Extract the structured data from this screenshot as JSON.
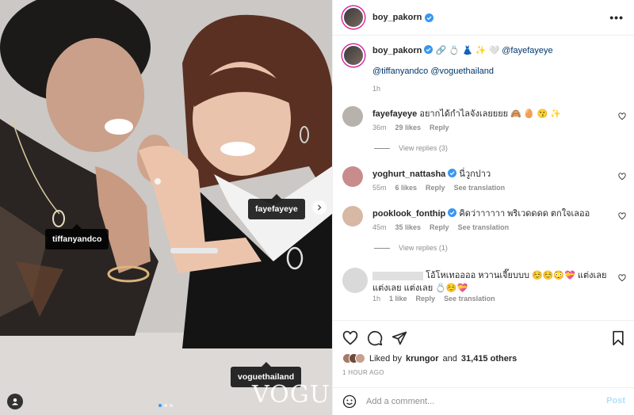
{
  "photo": {
    "tags": {
      "tiffany": "tiffanyandco",
      "faye": "fayefayeye",
      "vogue": "voguethailand"
    },
    "logo_text": "VOGUE"
  },
  "post": {
    "username": "boy_pakorn",
    "more_icon": "ellipsis-icon",
    "caption": {
      "emojis": "🔗 💍 👗 ✨ 🤍",
      "mention1": "@fayefayeye",
      "mention2": "@tiffanyandco",
      "mention3": "@voguethailand",
      "time": "1h"
    }
  },
  "comments": [
    {
      "user": "fayefayeye",
      "text": "อยากได้กำไลจังเลยยยย 🙈 🥚 😗 ✨",
      "time": "36m",
      "likes": "29 likes",
      "reply": "Reply",
      "avatar_color": "#b8b2ac"
    },
    {
      "user": "yoghurt_nattasha",
      "verified": true,
      "text": "นี่วูกปาว",
      "time": "55m",
      "likes": "6 likes",
      "reply": "Reply",
      "translate": "See translation",
      "avatar_color": "#c98c8c"
    },
    {
      "user": "pooklook_fonthip",
      "verified": true,
      "text": "คิดว่าาาาาา พริเวดดดด ตกใจเลออ",
      "time": "45m",
      "likes": "35 likes",
      "reply": "Reply",
      "translate": "See translation",
      "avatar_color": "#d7b8a5"
    },
    {
      "user": "",
      "text": "โอ้โหเทออออ หวานเจี๊ยบบบ ☺️☺️😳💝 แต่งเลย แต่งเลย แต่งเลย 💍☺️💝",
      "time": "1h",
      "likes": "1 like",
      "reply": "Reply",
      "translate": "See translation",
      "avatar_color": "#d9d9d9"
    }
  ],
  "view_replies": [
    "View replies (3)",
    "View replies (1)"
  ],
  "actions": {
    "like_icon": "heart-icon",
    "comment_icon": "comment-icon",
    "share_icon": "share-icon",
    "save_icon": "bookmark-icon",
    "liked_by_prefix": "Liked by",
    "liked_by_user": "krungor",
    "liked_by_and": "and",
    "liked_by_count": "31,415 others",
    "time": "1 HOUR AGO"
  },
  "add_comment": {
    "placeholder": "Add a comment...",
    "post_label": "Post",
    "emoji_icon": "smiley-icon"
  },
  "colors": {
    "verified": "#3897f0",
    "mention": "#00376b",
    "post_disabled": "#b2dffc",
    "meta": "#8e8e8e"
  }
}
